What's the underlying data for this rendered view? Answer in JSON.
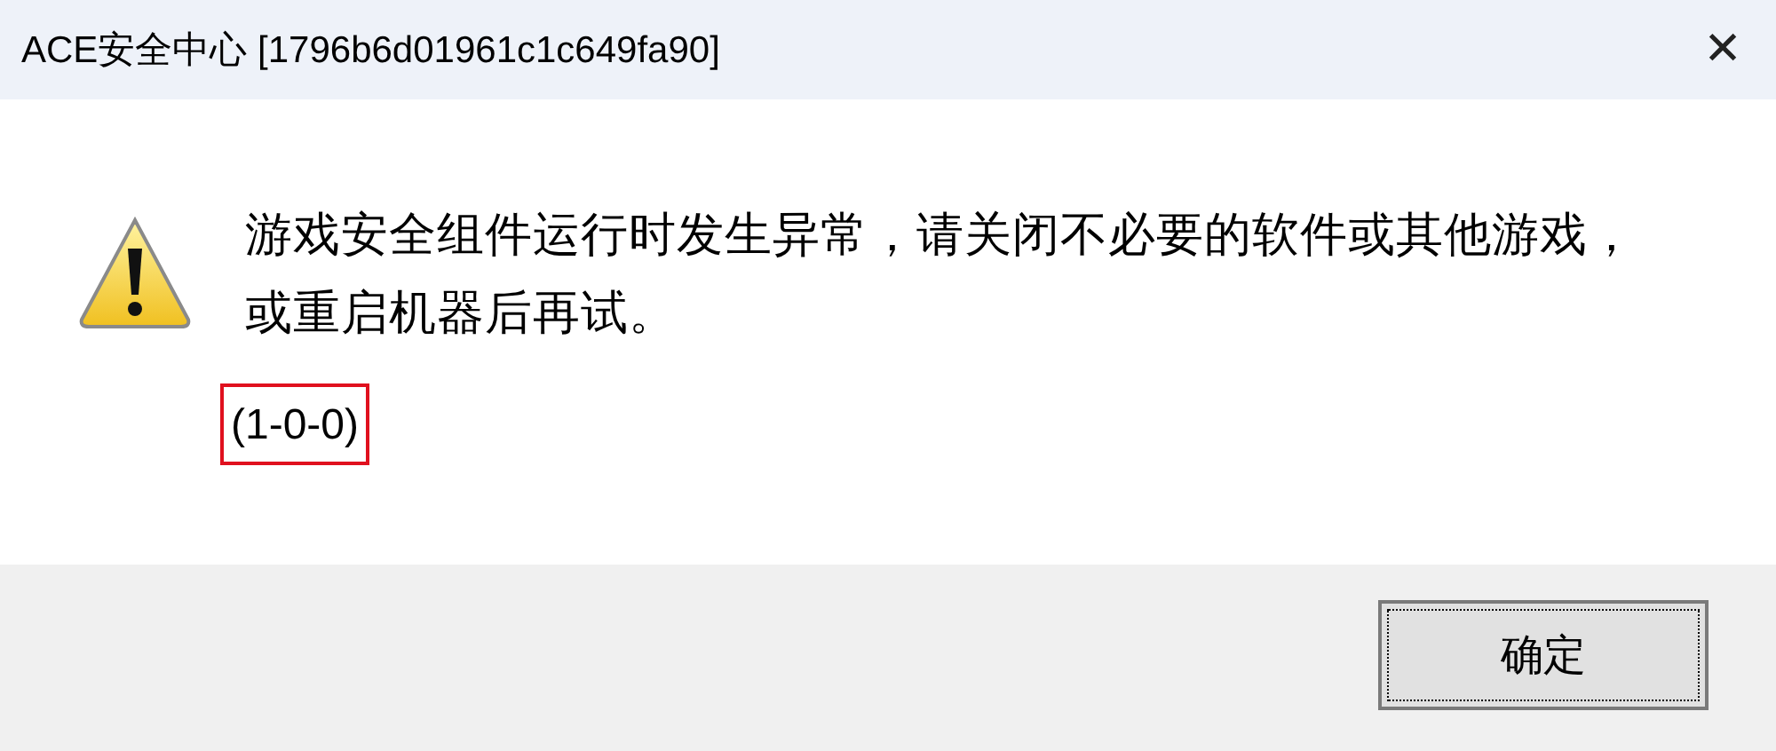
{
  "window": {
    "title": "ACE安全中心 [1796b6d01961c1c649fa90]",
    "close": "✕"
  },
  "message": {
    "text": "游戏安全组件运行时发生异常，请关闭不必要的软件或其他游戏，或重启机器后再试。",
    "code": "(1-0-0)",
    "code_highlighted": true
  },
  "buttons": [
    {
      "label": "确定",
      "default": true
    }
  ]
}
